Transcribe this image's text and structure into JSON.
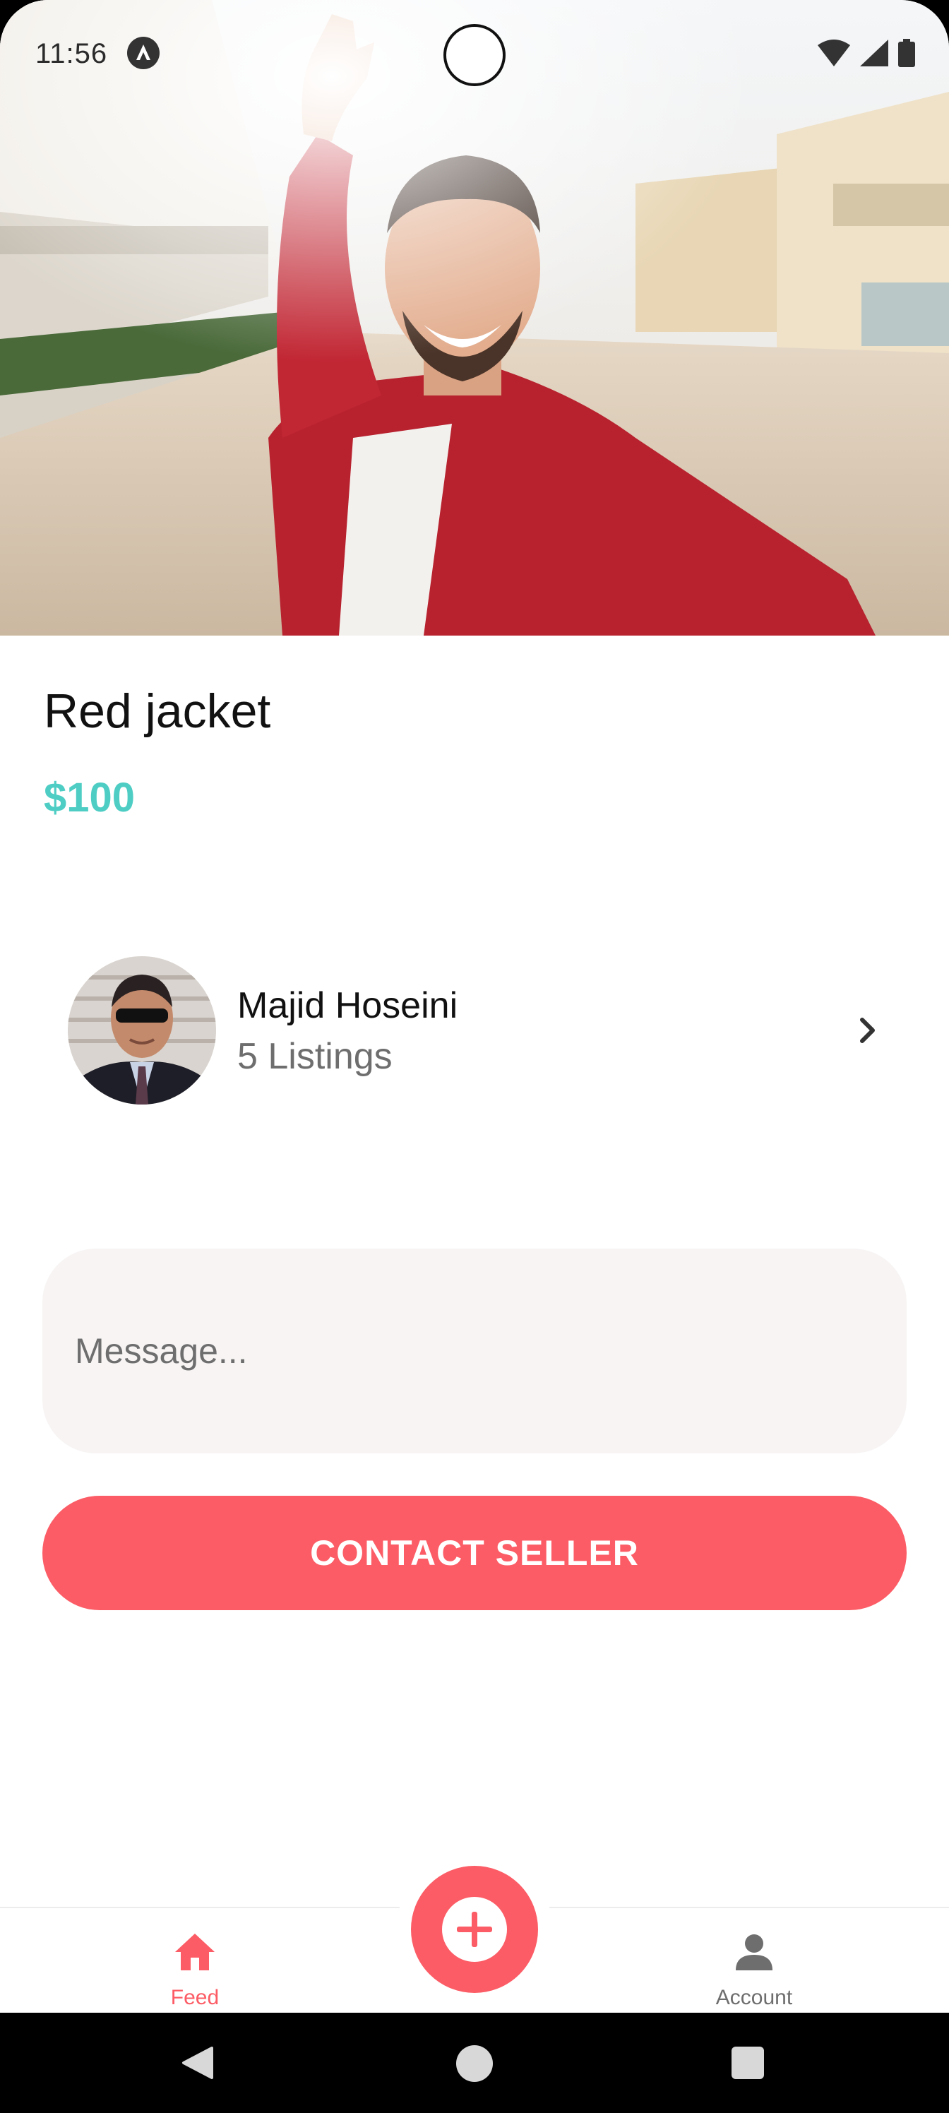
{
  "status_bar": {
    "time": "11:56",
    "icons": [
      "app-notification-icon",
      "wifi-icon",
      "signal-icon",
      "battery-icon"
    ]
  },
  "listing": {
    "image": "man-red-jacket-selfie-photo",
    "title": "Red jacket",
    "price": "$100"
  },
  "seller": {
    "name": "Majid Hoseini",
    "listings": "5 Listings"
  },
  "message": {
    "placeholder": "Message...",
    "value": ""
  },
  "contact_button": {
    "label": "CONTACT SELLER"
  },
  "tab_bar": {
    "tabs": [
      {
        "label": "Feed",
        "icon": "home-icon",
        "active": true
      },
      {
        "label": "Account",
        "icon": "person-icon",
        "active": false
      }
    ],
    "fab_icon": "plus-icon"
  },
  "colors": {
    "primary": "#FC5C65",
    "secondary": "#4ECDC4",
    "input_bg": "#F8F4F4",
    "medium_text": "#6E6E6E"
  }
}
